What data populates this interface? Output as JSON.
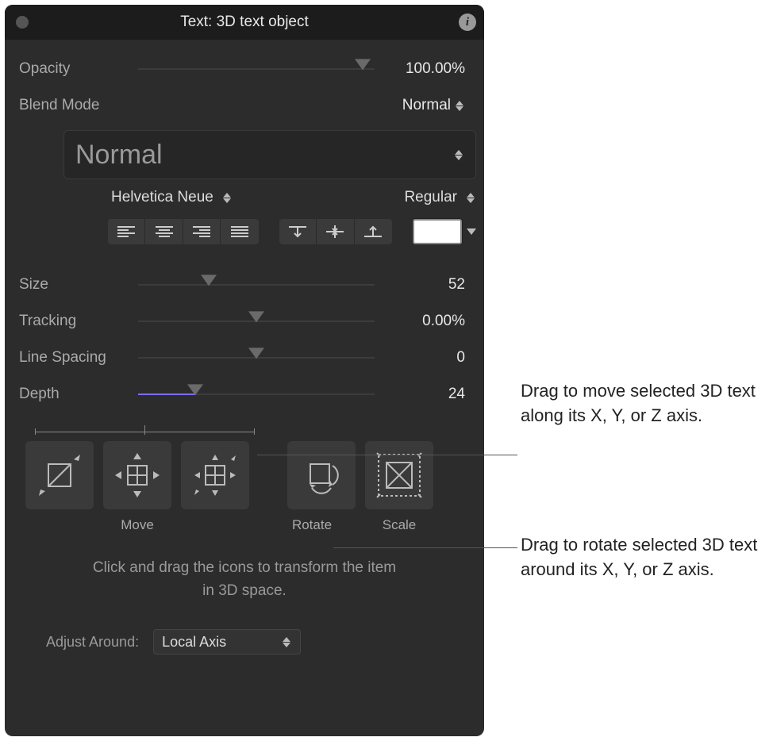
{
  "title": "Text: 3D text  object",
  "opacity": {
    "label": "Opacity",
    "value": "100.00%"
  },
  "blend": {
    "label": "Blend Mode",
    "value": "Normal"
  },
  "style_name": "Normal",
  "font": {
    "family": "Helvetica Neue",
    "weight": "Regular"
  },
  "size": {
    "label": "Size",
    "value": "52"
  },
  "tracking": {
    "label": "Tracking",
    "value": "0.00%"
  },
  "linespacing": {
    "label": "Line Spacing",
    "value": "0"
  },
  "depth": {
    "label": "Depth",
    "value": "24"
  },
  "xform": {
    "move_label": "Move",
    "rotate_label": "Rotate",
    "scale_label": "Scale"
  },
  "hint": "Click and drag the icons to transform the item in 3D space.",
  "adjust": {
    "label": "Adjust Around:",
    "value": "Local Axis"
  },
  "callouts": {
    "move": "Drag to move selected 3D text along its X, Y, or Z axis.",
    "rotate": "Drag to rotate selected 3D text around its X, Y, or Z axis."
  }
}
